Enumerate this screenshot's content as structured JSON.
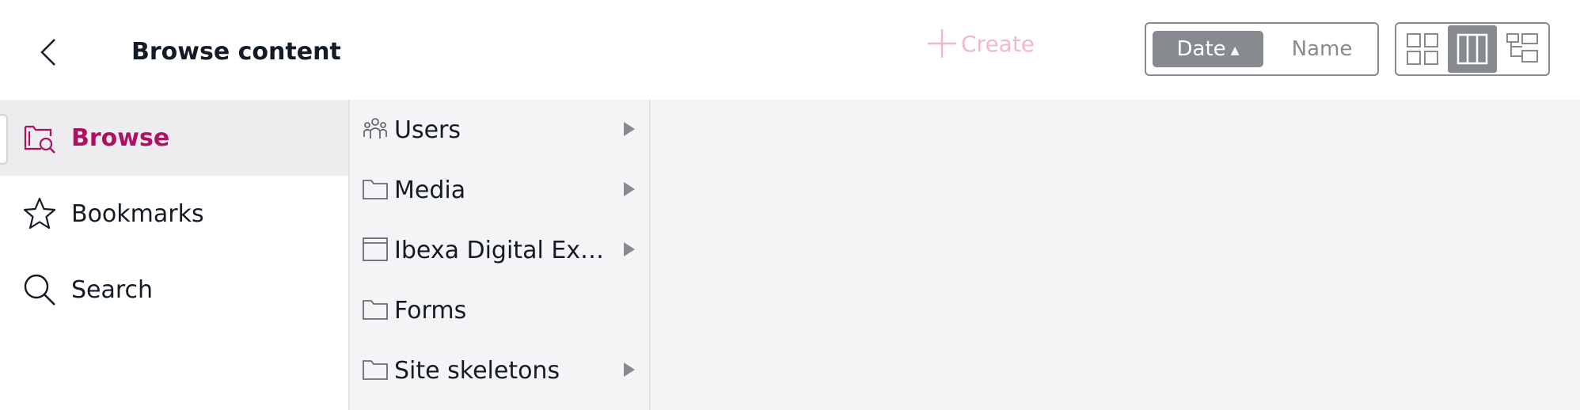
{
  "header": {
    "title": "Browse content",
    "create_label": "Create",
    "sort": {
      "date_label": "Date",
      "date_arrow": "▲",
      "name_label": "Name",
      "active": "Date"
    },
    "view_modes": [
      {
        "name": "grid",
        "active": false
      },
      {
        "name": "columns",
        "active": true
      },
      {
        "name": "tree",
        "active": false
      }
    ]
  },
  "sidebar": {
    "items": [
      {
        "label": "Browse",
        "icon": "browse-folder-search-icon",
        "active": true
      },
      {
        "label": "Bookmarks",
        "icon": "star-icon",
        "active": false
      },
      {
        "label": "Search",
        "icon": "search-icon",
        "active": false
      }
    ]
  },
  "tree": {
    "items": [
      {
        "label": "Users",
        "icon": "users-icon",
        "has_children": true
      },
      {
        "label": "Media",
        "icon": "folder-icon",
        "has_children": true
      },
      {
        "label": "Ibexa Digital Exp...",
        "icon": "landing-page-icon",
        "has_children": true
      },
      {
        "label": "Forms",
        "icon": "folder-icon",
        "has_children": false
      },
      {
        "label": "Site skeletons",
        "icon": "folder-icon",
        "has_children": true
      }
    ]
  },
  "colors": {
    "accent": "#ae1164",
    "create_disabled": "#f2b6d0",
    "muted_gray": "#878b90",
    "panel_bg": "#f4f4f6",
    "active_nav_bg": "#ededf0"
  }
}
